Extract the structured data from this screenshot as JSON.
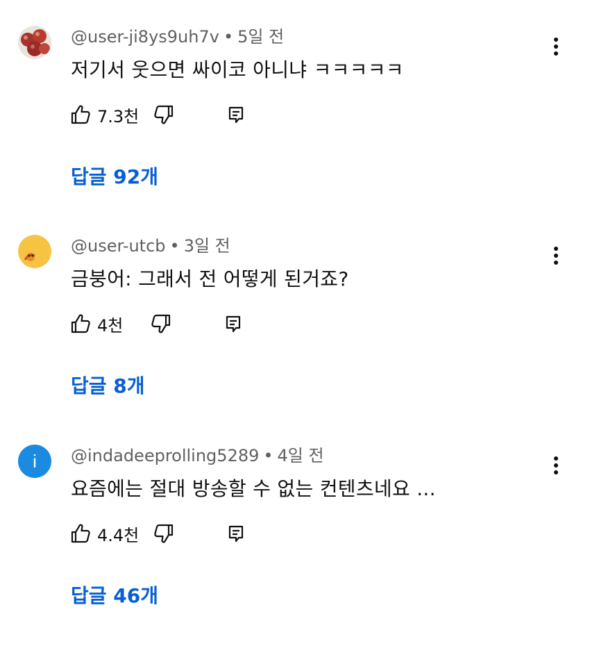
{
  "comments": [
    {
      "author": "@user-ji8ys9uh7v",
      "time": "5일 전",
      "text": "저기서 웃으면 싸이코 아니냐 ㅋㅋㅋㅋㅋ",
      "likes": "7.3천",
      "replies_label": "답글 92개",
      "avatar_icon": "apples-avatar-icon"
    },
    {
      "author": "@user-utcb",
      "time": "3일 전",
      "text": "금붕어: 그래서 전 어떻게 된거죠?",
      "likes": "4천",
      "replies_label": "답글 8개",
      "avatar_icon": "emoji-avatar-icon"
    },
    {
      "author": "@indadeeprolling5289",
      "time": "4일 전",
      "text": "요즘에는 절대 방송할 수 없는 컨텐츠네요 ...",
      "likes": "4.4천",
      "replies_label": "답글 46개",
      "avatar_icon": "letter-avatar-icon",
      "avatar_letter": "i"
    }
  ],
  "colors": {
    "link": "#065fd4",
    "meta": "#606060",
    "avatar_blue": "#1a8be0",
    "avatar_yellow": "#f6c342"
  },
  "separator": "•"
}
